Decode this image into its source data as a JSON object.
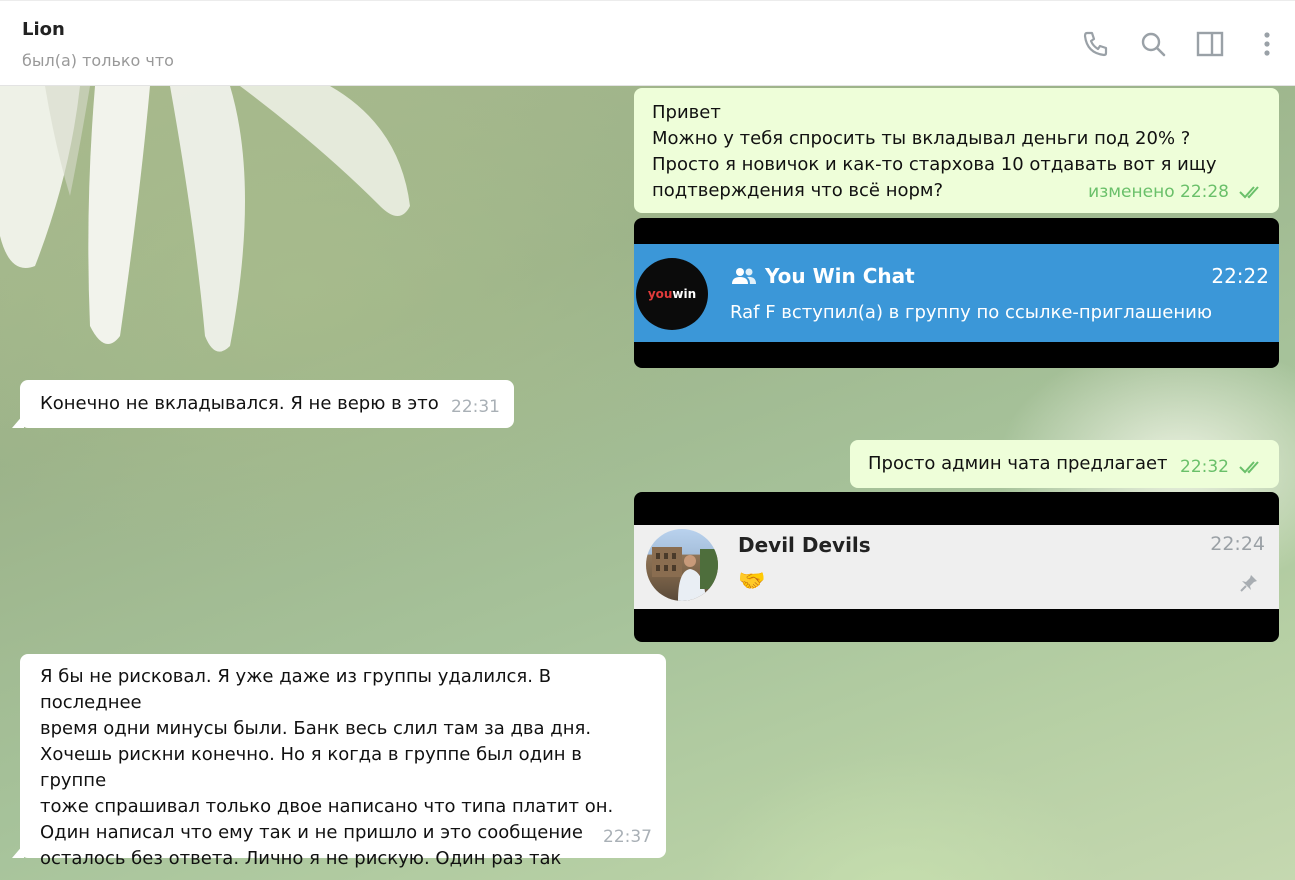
{
  "header": {
    "name": "Lion",
    "status": "был(а) только что",
    "icons": [
      "phone-icon",
      "search-icon",
      "sidebar-toggle-icon",
      "more-vertical-icon"
    ]
  },
  "messages": [
    {
      "direction": "out",
      "text": "Привет\nМожно у тебя спросить ты вкладывал деньги под 20% ?\nПросто я новичок и как-то стархова 10 отдавать вот я ищу\nподтверждения что всё норм?",
      "time": "изменено 22:28",
      "read": true
    },
    {
      "direction": "out",
      "kind": "screenshot",
      "chat_title": "You Win Chat",
      "chat_time": "22:22",
      "chat_preview": "Raf F вступил(а) в группу по ссылке-приглашению",
      "logo": {
        "red": "you",
        "white": "win"
      }
    },
    {
      "direction": "in",
      "text": "Конечно не вкладывался. Я не верю в это",
      "time": "22:31"
    },
    {
      "direction": "out",
      "text": "Просто админ чата предлагает",
      "time": "22:32",
      "read": true
    },
    {
      "direction": "out",
      "kind": "screenshot",
      "chat_title": "Devil Devils",
      "chat_time": "22:24",
      "chat_preview": "🤝",
      "pinned": true
    },
    {
      "direction": "in",
      "text": "Я бы не рисковал. Я уже даже из группы удалился. В последнее\nвремя одни минусы были. Банк весь слил там за два дня.\nХочешь рискни конечно. Но я когда в группе был один в группе\nтоже спрашивал только двое написано что типа платит он.\nОдин написал что ему так и не пришло и это сообщение\nосталось без ответа. Лично я не рискую. Один раз так вложился\nпо началу и попращался с деньгами.",
      "time": "22:37"
    }
  ],
  "colors": {
    "out_bubble": "#eefed9",
    "in_bubble": "#ffffff",
    "read_check": "#6ac06a",
    "telegram_blue": "#3b97d8"
  }
}
